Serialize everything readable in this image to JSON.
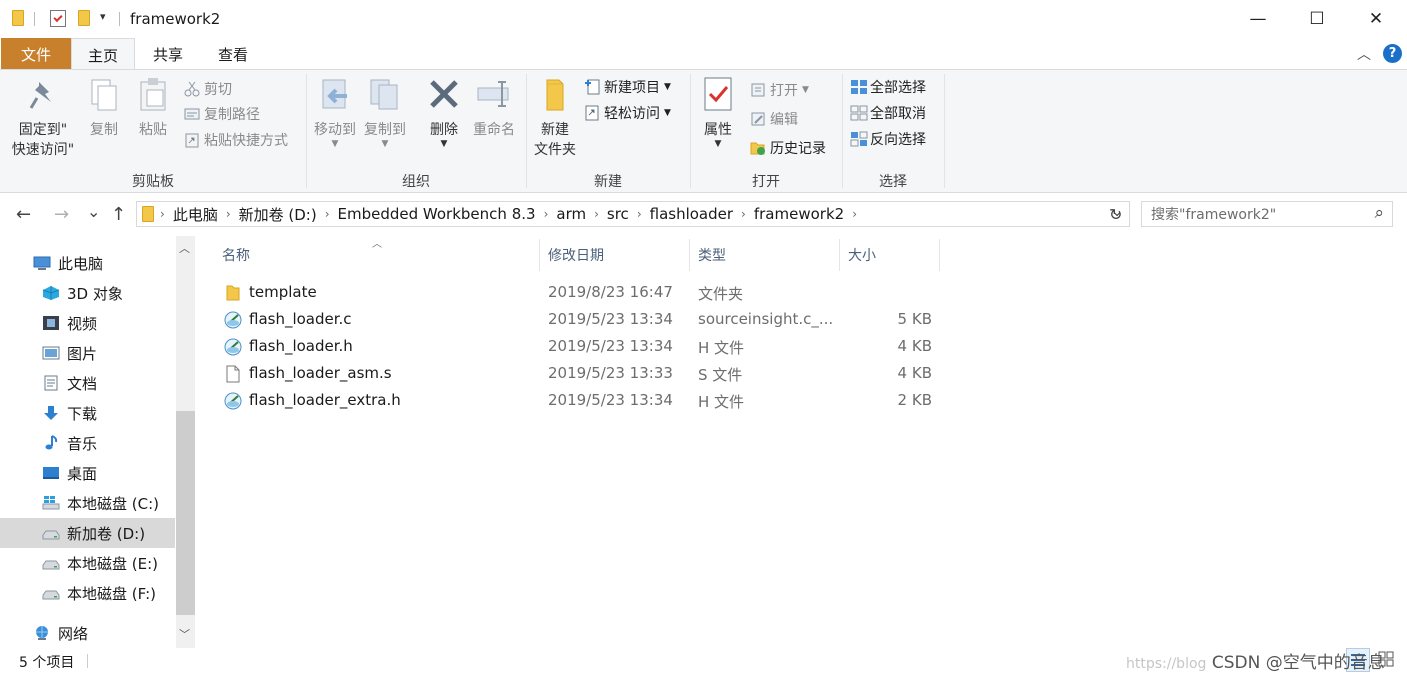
{
  "window": {
    "title": "framework2",
    "minimize_glyph": "—",
    "maximize_glyph": "☐",
    "close_glyph": "✕",
    "quick_access_glyph": "▾"
  },
  "ribbon_tabs": {
    "file": "文件",
    "home": "主页",
    "share": "共享",
    "view": "查看"
  },
  "ribbon_right": {
    "collapse_glyph": "︿",
    "help_glyph": "?"
  },
  "ribbon": {
    "clipboard": {
      "label": "剪贴板",
      "pin": [
        "固定到\"",
        "快速访问\""
      ],
      "copy": "复制",
      "paste": "粘贴",
      "cut": "剪切",
      "copy_path": "复制路径",
      "paste_shortcut": "粘贴快捷方式"
    },
    "organize": {
      "label": "组织",
      "move_to": "移动到",
      "copy_to": "复制到",
      "delete": "删除",
      "rename": "重命名"
    },
    "new": {
      "label": "新建",
      "new_folder": [
        "新建",
        "文件夹"
      ],
      "new_item": "新建项目",
      "easy_access": "轻松访问"
    },
    "open": {
      "label": "打开",
      "properties": "属性",
      "open": "打开",
      "edit": "编辑",
      "history": "历史记录"
    },
    "select": {
      "label": "选择",
      "select_all": "全部选择",
      "select_none": "全部取消",
      "invert": "反向选择"
    }
  },
  "nav": {
    "back_glyph": "←",
    "forward_glyph": "→",
    "recent_glyph": "⌄",
    "up_glyph": "↑",
    "breadcrumb": [
      "此电脑",
      "新加卷 (D:)",
      "Embedded Workbench 8.3",
      "arm",
      "src",
      "flashloader",
      "framework2"
    ],
    "crumb_sep": "›",
    "dropdown_glyph": "⌄",
    "refresh_glyph": "↻",
    "search_placeholder": "搜索\"framework2\"",
    "search_glyph": "⌕"
  },
  "sidebar": {
    "items": [
      {
        "label": "此电脑",
        "icon": "pc-icon"
      },
      {
        "label": "3D 对象",
        "icon": "3d-objects-icon"
      },
      {
        "label": "视频",
        "icon": "video-icon"
      },
      {
        "label": "图片",
        "icon": "pictures-icon"
      },
      {
        "label": "文档",
        "icon": "documents-icon"
      },
      {
        "label": "下载",
        "icon": "download-icon"
      },
      {
        "label": "音乐",
        "icon": "music-icon"
      },
      {
        "label": "桌面",
        "icon": "desktop-icon"
      },
      {
        "label": "本地磁盘 (C:)",
        "icon": "windows-drive-icon"
      },
      {
        "label": "新加卷 (D:)",
        "icon": "drive-icon",
        "selected": true
      },
      {
        "label": "本地磁盘 (E:)",
        "icon": "drive-icon"
      },
      {
        "label": "本地磁盘 (F:)",
        "icon": "drive-icon"
      },
      {
        "label": "网络",
        "icon": "network-icon"
      }
    ],
    "scroll_up_glyph": "︿",
    "scroll_down_glyph": "﹀"
  },
  "files": {
    "columns": {
      "name": "名称",
      "modified": "修改日期",
      "type": "类型",
      "size": "大小"
    },
    "sort_glyph": "︿",
    "rows": [
      {
        "name": "template",
        "modified": "2019/8/23 16:47",
        "type": "文件夹",
        "size": "",
        "icon": "folder-icon"
      },
      {
        "name": "flash_loader.c",
        "modified": "2019/5/23 13:34",
        "type": "sourceinsight.c_...",
        "size": "5 KB",
        "icon": "source-file-icon"
      },
      {
        "name": "flash_loader.h",
        "modified": "2019/5/23 13:34",
        "type": "H 文件",
        "size": "4 KB",
        "icon": "source-file-icon"
      },
      {
        "name": "flash_loader_asm.s",
        "modified": "2019/5/23 13:33",
        "type": "S 文件",
        "size": "4 KB",
        "icon": "blank-file-icon"
      },
      {
        "name": "flash_loader_extra.h",
        "modified": "2019/5/23 13:34",
        "type": "H 文件",
        "size": "2 KB",
        "icon": "source-file-icon"
      }
    ]
  },
  "status": {
    "count": "5 个项目",
    "watermark_url": "https://blog",
    "watermark": "CSDN @空气中的音息"
  },
  "colors": {
    "file_tab": "#c8802d",
    "selected_nav": "#d9d9d9",
    "column_header": "#4c607a"
  }
}
